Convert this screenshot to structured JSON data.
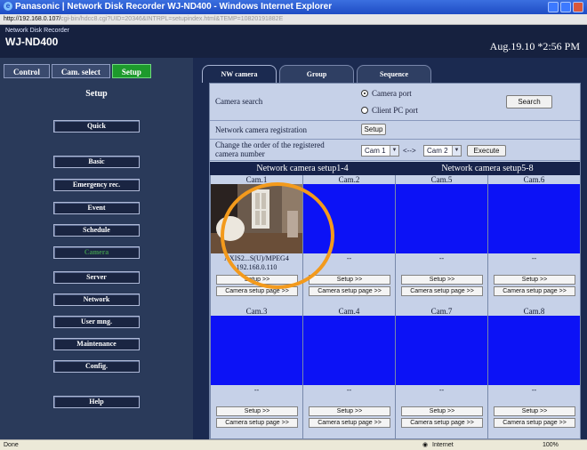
{
  "window": {
    "title": "Panasonic | Network Disk Recorder WJ-ND400 - Windows Internet Explorer",
    "address_host": "http://192.168.0.107/",
    "address_rest": "cgi-bin/hdcc8.cgi?UID=20346&INTRPL=setupindex.html&TEMP=10820191882E"
  },
  "header": {
    "brand_small": "Network Disk Recorder",
    "brand_model": "WJ-ND400",
    "datetime": "Aug.19.10  *2:56  PM"
  },
  "main_tabs": [
    {
      "label": "Control"
    },
    {
      "label": "Cam. select"
    },
    {
      "label": "Setup",
      "active": true
    }
  ],
  "sidebar": {
    "title": "Setup",
    "items": [
      {
        "label": "Quick"
      },
      {
        "label": "Basic"
      },
      {
        "label": "Emergency rec."
      },
      {
        "label": "Event"
      },
      {
        "label": "Schedule"
      },
      {
        "label": "Camera"
      },
      {
        "label": "Server"
      },
      {
        "label": "Network"
      },
      {
        "label": "User mng."
      },
      {
        "label": "Maintenance"
      },
      {
        "label": "Config."
      },
      {
        "label": "Help"
      }
    ]
  },
  "sub_tabs": [
    {
      "label": "NW camera",
      "active": true
    },
    {
      "label": "Group"
    },
    {
      "label": "Sequence"
    }
  ],
  "camera_search": {
    "label": "Camera search",
    "option_camera_port": "Camera port",
    "option_client_pc_port": "Client PC port",
    "selected": "Camera port",
    "search_button": "Search"
  },
  "registration": {
    "label": "Network camera registration",
    "setup_button": "Setup"
  },
  "order": {
    "label": "Change the order of the registered camera number",
    "from_value": "Cam 1",
    "arrow": "<-->",
    "to_value": "Cam 2",
    "execute_button": "Execute"
  },
  "grid": {
    "band_left": "Network camera setup1-4",
    "band_right": "Network camera setup5-8",
    "setup_btn": "Setup >>",
    "camera_page_btn": "Camera setup page >>",
    "row1": [
      {
        "name": "Cam.1",
        "model": "AXIS2...S(U)/MPEG4",
        "ip": "192.168.0.110"
      },
      {
        "name": "Cam.2",
        "model": "--",
        "ip": ""
      },
      {
        "name": "Cam.5",
        "model": "--",
        "ip": ""
      },
      {
        "name": "Cam.6",
        "model": "--",
        "ip": ""
      }
    ],
    "row2": [
      {
        "name": "Cam.3",
        "model": "--",
        "ip": ""
      },
      {
        "name": "Cam.4",
        "model": "--",
        "ip": ""
      },
      {
        "name": "Cam.7",
        "model": "--",
        "ip": ""
      },
      {
        "name": "Cam.8",
        "model": "--",
        "ip": ""
      }
    ]
  },
  "statusbar": {
    "left": "Done",
    "zone": "Internet",
    "zoom": "100%"
  },
  "colors": {
    "header_bg": "#16213f",
    "active_tab": "#1d9a2c",
    "panel_bg": "#c6d1e8",
    "video_blue": "#0c12f6",
    "annotation_circle": "#f39a1c"
  }
}
